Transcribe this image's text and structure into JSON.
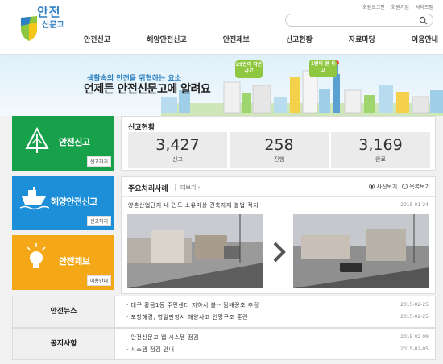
{
  "header": {
    "logo_line1": "안전",
    "logo_line2": "신문고",
    "util_links": [
      "회원로그인",
      "회원가입",
      "사이트맵"
    ],
    "search_placeholder": "",
    "nav": [
      "안전신고",
      "해양안전신고",
      "안전제보",
      "신고현황",
      "자료마당",
      "이용안내"
    ]
  },
  "banner": {
    "subtitle": "생활속의 안전을 위협하는 요소",
    "title": "언제든 안전신문고에 알려요",
    "bubble1": "29번의 작은 사고",
    "bubble2": "1번의 큰 사고"
  },
  "tiles": [
    {
      "label": "안전신고",
      "button": "신고하기"
    },
    {
      "label": "해양안전신고",
      "button": "신고하기"
    },
    {
      "label": "안전제보",
      "button": "이용안내"
    }
  ],
  "stats": {
    "title": "신고현황",
    "items": [
      {
        "value": "3,427",
        "label": "신고"
      },
      {
        "value": "258",
        "label": "진행"
      },
      {
        "value": "3,169",
        "label": "완료"
      }
    ]
  },
  "cases": {
    "title": "주요처리사례",
    "more": "더보기",
    "view_photo": "사진보기",
    "view_list": "목록보기",
    "headline": "양촌산업단지 내 인도 소유미상 건축자재 불법 적치",
    "date": "2015-01-24"
  },
  "news": {
    "title": "안전뉴스",
    "items": [
      {
        "text": "대구 황금1동 주민센터 지하서 불-- 담배꽁초 추정",
        "date": "2015-02-25"
      },
      {
        "text": "포항해경, 영일만항서 해양사고 인명구조 훈련",
        "date": "2015-02-25"
      }
    ]
  },
  "notice": {
    "title": "공지사항",
    "items": [
      {
        "text": "안전신문고 웹 시스템 점검",
        "date": "2015-02-09"
      },
      {
        "text": "시스템 점검 안내",
        "date": "2015-02-05"
      }
    ]
  },
  "colors": {
    "tile_green": "#16a14a",
    "tile_blue": "#1d8fd8",
    "tile_orange": "#f5a817",
    "brand_blue": "#2f7fc4"
  }
}
